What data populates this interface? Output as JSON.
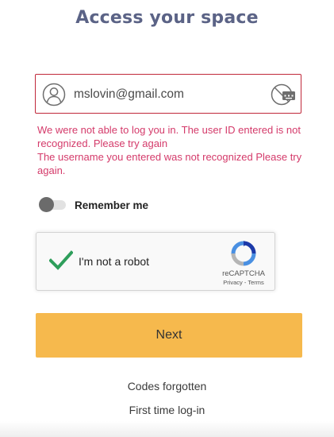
{
  "header": {
    "title": "Access your space"
  },
  "login": {
    "value": "mslovin@gmail.com",
    "icon": "user-icon",
    "keyboard_icon": "virtual-keyboard-icon",
    "border_color": "#c0283a"
  },
  "errors": {
    "line1": "We were not able to log you in. The user ID entered is not recognized. Please try again",
    "line2": "The username you entered was not recognized Please try again.",
    "color": "#d43a6a"
  },
  "remember": {
    "label": "Remember me",
    "checked": false
  },
  "captcha": {
    "label": "I'm not a robot",
    "brand": "reCAPTCHA",
    "privacy": "Privacy",
    "separator": " - ",
    "terms": "Terms",
    "checked": true
  },
  "actions": {
    "next_label": "Next",
    "next_color": "#f6b94d",
    "codes_forgotten": "Codes forgotten",
    "first_time": "First time log-in"
  }
}
